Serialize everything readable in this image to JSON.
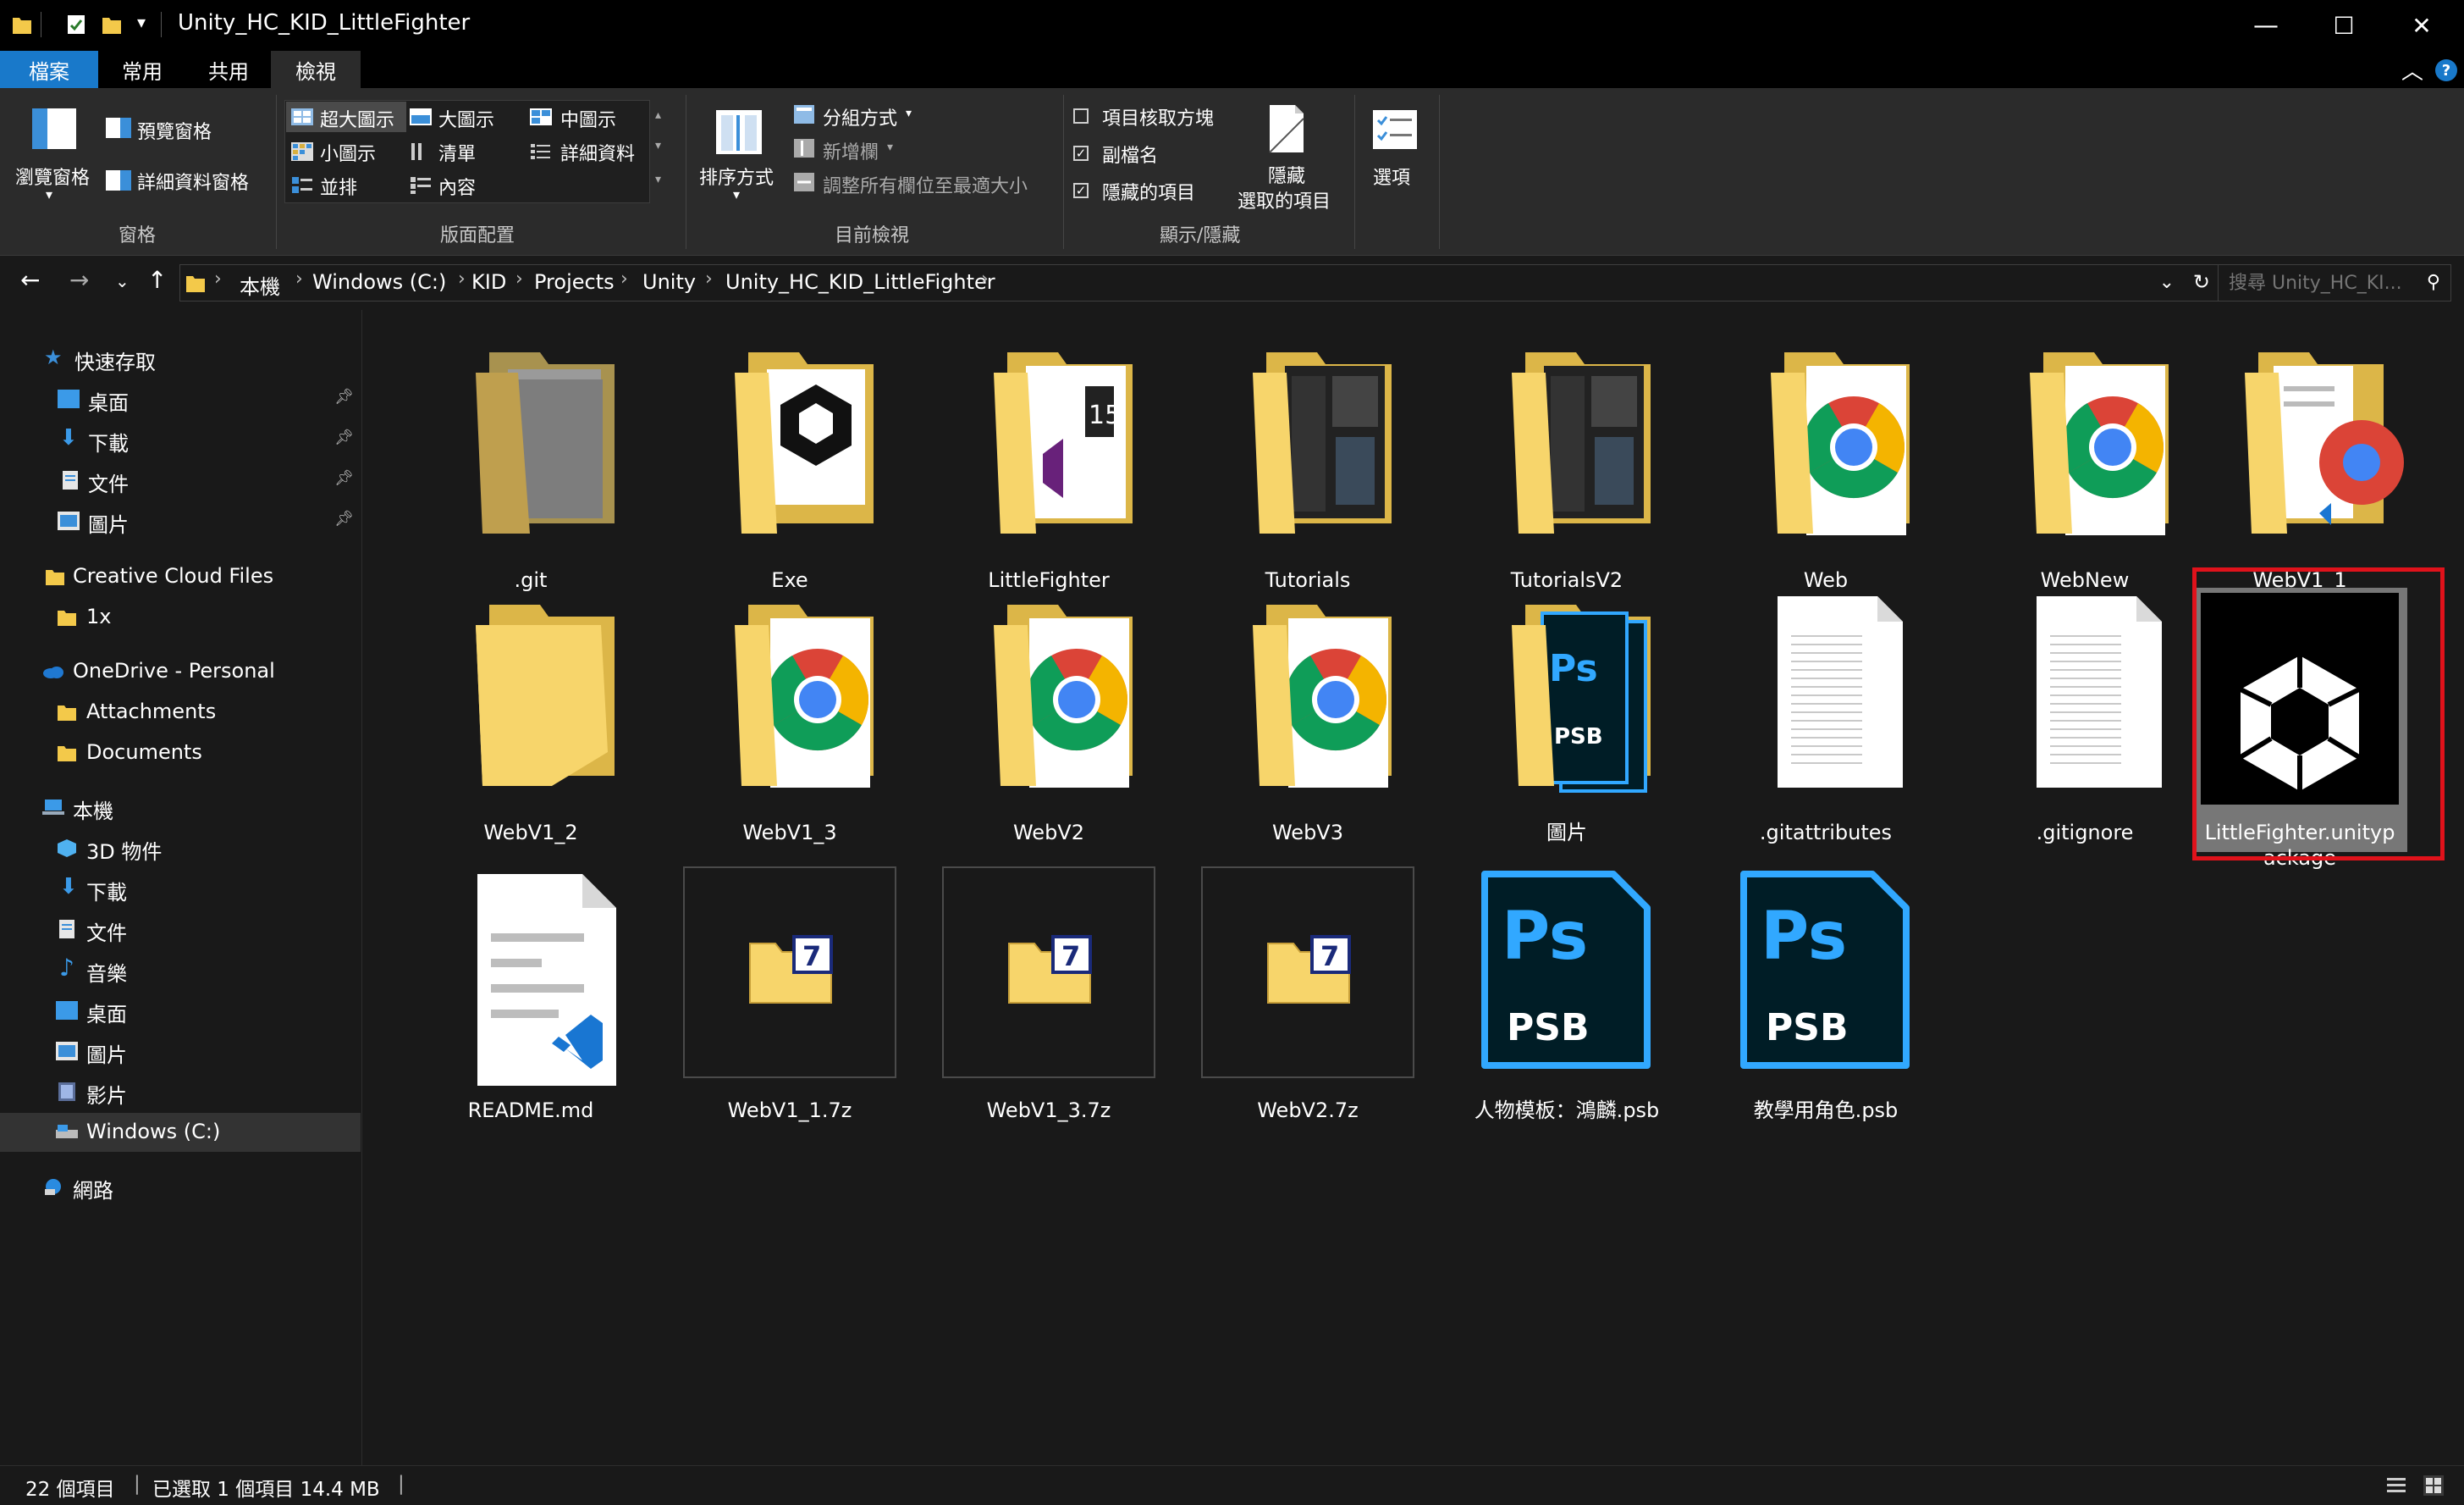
{
  "window": {
    "title": "Unity_HC_KID_LittleFighter",
    "minimize": "—",
    "maximize": "☐",
    "close": "✕"
  },
  "ribbon_tabs": [
    "檔案",
    "常用",
    "共用",
    "檢視"
  ],
  "ribbon": {
    "panes": {
      "navigation_pane": "瀏覽窗格",
      "preview_pane": "預覽窗格",
      "details_pane": "詳細資料窗格",
      "group": "窗格"
    },
    "layout": {
      "extra_large": "超大圖示",
      "large": "大圖示",
      "medium": "中圖示",
      "small": "小圖示",
      "list": "清單",
      "details": "詳細資料",
      "tiles": "並排",
      "content": "內容",
      "group": "版面配置"
    },
    "current_view": {
      "sort_by": "排序方式",
      "group_by": "分組方式",
      "add_columns": "新增欄",
      "size_columns": "調整所有欄位至最適大小",
      "group": "目前檢視"
    },
    "show_hide": {
      "item_checkboxes": "項目核取方塊",
      "file_extensions": "副檔名",
      "hidden_items": "隱藏的項目",
      "hide_selected_line1": "隱藏",
      "hide_selected_line2": "選取的項目",
      "options": "選項",
      "group": "顯示/隱藏",
      "checked": {
        "item_checkboxes": false,
        "file_extensions": true,
        "hidden_items": true
      }
    }
  },
  "address": {
    "crumbs": [
      "本機",
      "Windows (C:)",
      "KID",
      "Projects",
      "Unity",
      "Unity_HC_KID_LittleFighter"
    ],
    "search_placeholder": "搜尋 Unity_HC_KI..."
  },
  "sidebar": {
    "quick_access": "快速存取",
    "quick_items": [
      "桌面",
      "下載",
      "文件",
      "圖片"
    ],
    "creative_cloud": "Creative Cloud Files",
    "cc_items": [
      "1x"
    ],
    "onedrive": "OneDrive - Personal",
    "onedrive_items": [
      "Attachments",
      "Documents"
    ],
    "this_pc": "本機",
    "pc_items": [
      "3D 物件",
      "下載",
      "文件",
      "音樂",
      "桌面",
      "圖片",
      "影片",
      "Windows (C:)"
    ],
    "network": "網路"
  },
  "files": [
    {
      "name": ".git",
      "kind": "folder-plain"
    },
    {
      "name": "Exe",
      "kind": "folder-unity"
    },
    {
      "name": "LittleFighter",
      "kind": "folder-vs"
    },
    {
      "name": "Tutorials",
      "kind": "folder-dark"
    },
    {
      "name": "TutorialsV2",
      "kind": "folder-dark"
    },
    {
      "name": "Web",
      "kind": "folder-chrome"
    },
    {
      "name": "WebNew",
      "kind": "folder-chrome"
    },
    {
      "name": "WebV1_1",
      "kind": "folder-mixed"
    },
    {
      "name": "WebV1_2",
      "kind": "folder-empty"
    },
    {
      "name": "WebV1_3",
      "kind": "folder-chrome"
    },
    {
      "name": "WebV2",
      "kind": "folder-chrome"
    },
    {
      "name": "WebV3",
      "kind": "folder-chrome"
    },
    {
      "name": "圖片",
      "kind": "folder-ps"
    },
    {
      "name": ".gitattributes",
      "kind": "text-file"
    },
    {
      "name": ".gitignore",
      "kind": "text-file"
    },
    {
      "name": "LittleFighter.unitypackage",
      "kind": "unitypackage",
      "selected": true
    },
    {
      "name": "README.md",
      "kind": "markdown"
    },
    {
      "name": "WebV1_1.7z",
      "kind": "7z"
    },
    {
      "name": "WebV1_3.7z",
      "kind": "7z"
    },
    {
      "name": "WebV2.7z",
      "kind": "7z"
    },
    {
      "name": "人物模板：鴻麟.psb",
      "kind": "psb"
    },
    {
      "name": "教學用角色.psb",
      "kind": "psb"
    }
  ],
  "status": {
    "item_count": "22 個項目",
    "selection": "已選取 1 個項目  14.4 MB"
  },
  "colors": {
    "accent": "#1979ca",
    "selection_outline": "#e0121b",
    "folder": "#f7d56b",
    "photoshop": "#31a8ff"
  }
}
